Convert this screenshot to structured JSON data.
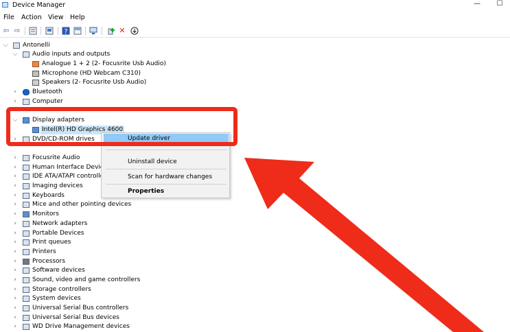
{
  "window": {
    "title": "Device Manager"
  },
  "menu": [
    "File",
    "Action",
    "View",
    "Help"
  ],
  "toolbar": {
    "icons": [
      "back-arrow-icon",
      "forward-arrow-icon",
      "properties-icon",
      "computer-icon",
      "help-icon",
      "view-icon",
      "monitor-icon",
      "add-driver-icon",
      "uninstall-icon",
      "download-icon"
    ]
  },
  "tree": {
    "root": "Antonelli",
    "audio": {
      "label": "Audio inputs and outputs",
      "children": [
        "Analogue 1 + 2 (2- Focusrite Usb Audio)",
        "Microphone (HD Webcam C310)",
        "Speakers (2- Focusrite Usb Audio)"
      ]
    },
    "bluetooth": "Bluetooth",
    "computer": "Computer",
    "display": {
      "label": "Display adapters",
      "child": "Intel(R) HD Graphics 4600"
    },
    "dvd": "DVD/CD-ROM drives",
    "categories": [
      "Focusrite Audio",
      "Human Interface Devices",
      "IDE ATA/ATAPI controllers",
      "Imaging devices",
      "Keyboards",
      "Mice and other pointing devices",
      "Monitors",
      "Network adapters",
      "Portable Devices",
      "Print queues",
      "Printers",
      "Processors",
      "Software devices",
      "Sound, video and game controllers",
      "Storage controllers",
      "System devices",
      "Universal Serial Bus controllers",
      "Universal Serial Bus devices",
      "WD Drive Management devices"
    ]
  },
  "context_menu": {
    "update": "Update driver",
    "uninstall": "Uninstall device",
    "scan": "Scan for hardware changes",
    "properties": "Properties"
  },
  "colors": {
    "annotation": "#ef2b1a",
    "selection": "#cce4f7",
    "menu_highlight": "#91c9f7"
  }
}
